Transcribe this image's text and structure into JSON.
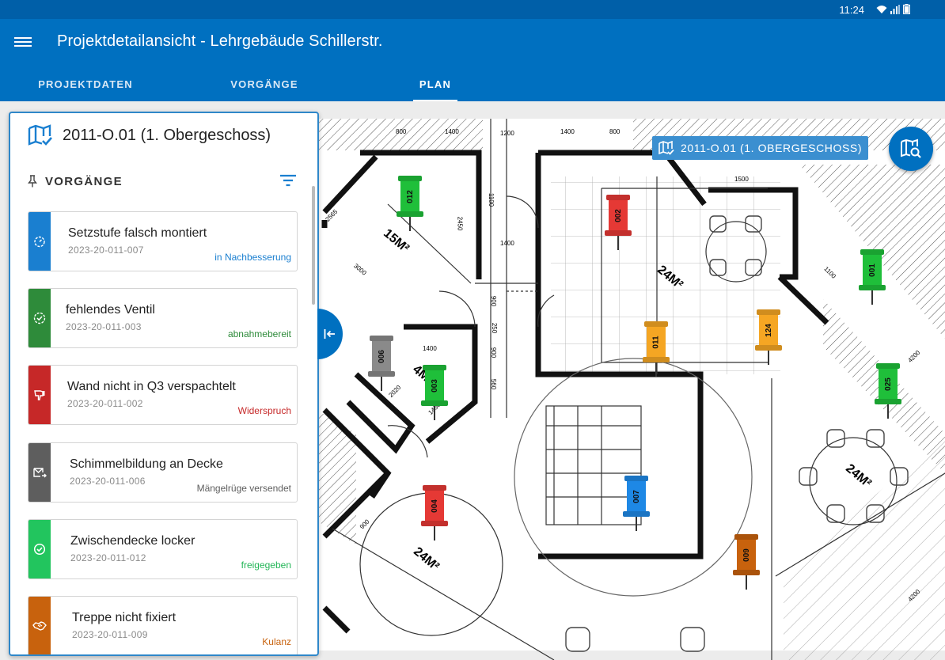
{
  "statusbar": {
    "time": "11:24",
    "icons": [
      "wifi-icon",
      "signal-icon",
      "battery-icon"
    ]
  },
  "appbar": {
    "title": "Projektdetailansicht - Lehrgebäude Schillerstr."
  },
  "tabs": [
    {
      "label": "PROJEKTDATEN",
      "active": false
    },
    {
      "label": "VORGÄNGE",
      "active": false
    },
    {
      "label": "PLAN",
      "active": true
    }
  ],
  "panel": {
    "floor_title": "2011-O.01 (1. Obergeschoss)",
    "section_label": "VORGÄNGE",
    "items": [
      {
        "title": "Setzstufe falsch montiert",
        "code": "2023-20-011-007",
        "status": "in Nachbesserung",
        "color": "#1a7fd0",
        "status_color": "#1a7fd0",
        "icon": "timer-icon"
      },
      {
        "title": "fehlendes Ventil",
        "code": "2023-20-011-003",
        "status": "abnahmebereit",
        "color": "#2e8b3a",
        "status_color": "#2e8b3a",
        "icon": "check-circle-dashed-icon"
      },
      {
        "title": "Wand nicht in Q3 verspachtelt",
        "code": "2023-20-011-002",
        "status": "Widerspruch",
        "color": "#c62828",
        "status_color": "#c62828",
        "icon": "thumb-down-icon"
      },
      {
        "title": "Schimmelbildung an Decke",
        "code": "2023-20-011-006",
        "status": "Mängelrüge versendet",
        "color": "#5e5e5e",
        "status_color": "#5e5e5e",
        "icon": "mail-forward-icon"
      },
      {
        "title": "Zwischendecke locker",
        "code": "2023-20-011-012",
        "status": "freigegeben",
        "color": "#22c55e",
        "status_color": "#22b556",
        "icon": "check-circle-icon"
      },
      {
        "title": "Treppe nicht fixiert",
        "code": "2023-20-011-009",
        "status": "Kulanz",
        "color": "#c8620d",
        "status_color": "#c8620d",
        "icon": "handshake-icon"
      }
    ]
  },
  "plan": {
    "floor_chip": "2011-O.01 (1. OBERGESCHOSS)",
    "pins": [
      {
        "num": "012",
        "color": "#1fbf3a"
      },
      {
        "num": "002",
        "color": "#e53935"
      },
      {
        "num": "001",
        "color": "#1fbf3a"
      },
      {
        "num": "124",
        "color": "#f5a623"
      },
      {
        "num": "011",
        "color": "#f5a623"
      },
      {
        "num": "006",
        "color": "#8a8a8a"
      },
      {
        "num": "003",
        "color": "#1fbf3a"
      },
      {
        "num": "025",
        "color": "#1fbf3a"
      },
      {
        "num": "007",
        "color": "#1e88e5"
      },
      {
        "num": "004",
        "color": "#e53935"
      },
      {
        "num": "009",
        "color": "#c8620d"
      }
    ],
    "room_labels": [
      "15M²",
      "24M²",
      "4M²",
      "24M²",
      "24M²"
    ],
    "dimension_labels": [
      "800",
      "1400",
      "1200",
      "1400",
      "800",
      "1500",
      "1100",
      "1400",
      "2450",
      "3000",
      "1400",
      "900",
      "250",
      "900",
      "560",
      "2565",
      "2020",
      "1450",
      "1100",
      "900",
      "4200",
      "4200"
    ]
  }
}
